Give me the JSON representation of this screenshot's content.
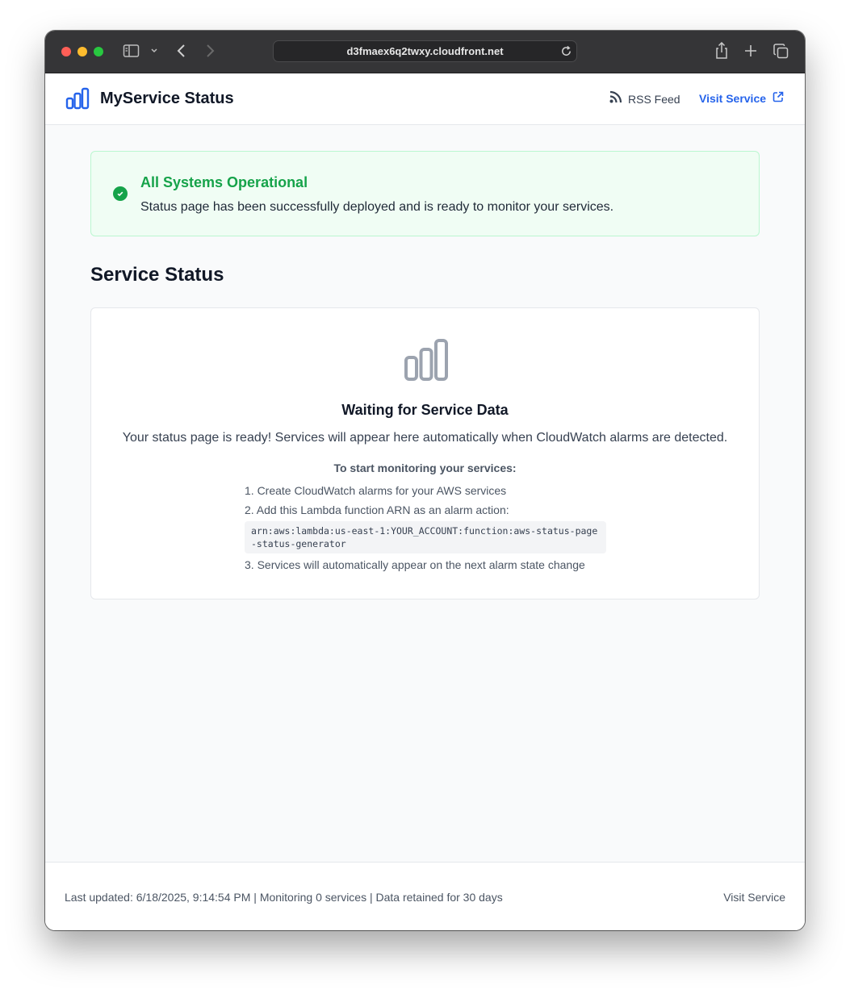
{
  "browser": {
    "url": "d3fmaex6q2twxy.cloudfront.net"
  },
  "header": {
    "title": "MyService Status",
    "rss_label": "RSS Feed",
    "visit_label": "Visit Service",
    "brand_color": "#2563eb"
  },
  "banner": {
    "title": "All Systems Operational",
    "message": "Status page has been successfully deployed and is ready to monitor your services.",
    "status_color": "#16a34a",
    "icon": "check-circle-icon"
  },
  "main": {
    "section_title": "Service Status",
    "empty_state": {
      "icon": "bar-chart-icon",
      "title": "Waiting for Service Data",
      "description": "Your status page is ready! Services will appear here automatically when CloudWatch alarms are detected.",
      "steps_title": "To start monitoring your services:",
      "steps": [
        "1. Create CloudWatch alarms for your AWS services",
        "2. Add this Lambda function ARN as an alarm action:",
        "3. Services will automatically appear on the next alarm state change"
      ],
      "arn": "arn:aws:lambda:us-east-1:YOUR_ACCOUNT:function:aws-status-page-status-generator"
    }
  },
  "footer": {
    "status_text": "Last updated: 6/18/2025, 9:14:54 PM | Monitoring 0 services | Data retained for 30 days",
    "visit_link": "Visit Service"
  }
}
